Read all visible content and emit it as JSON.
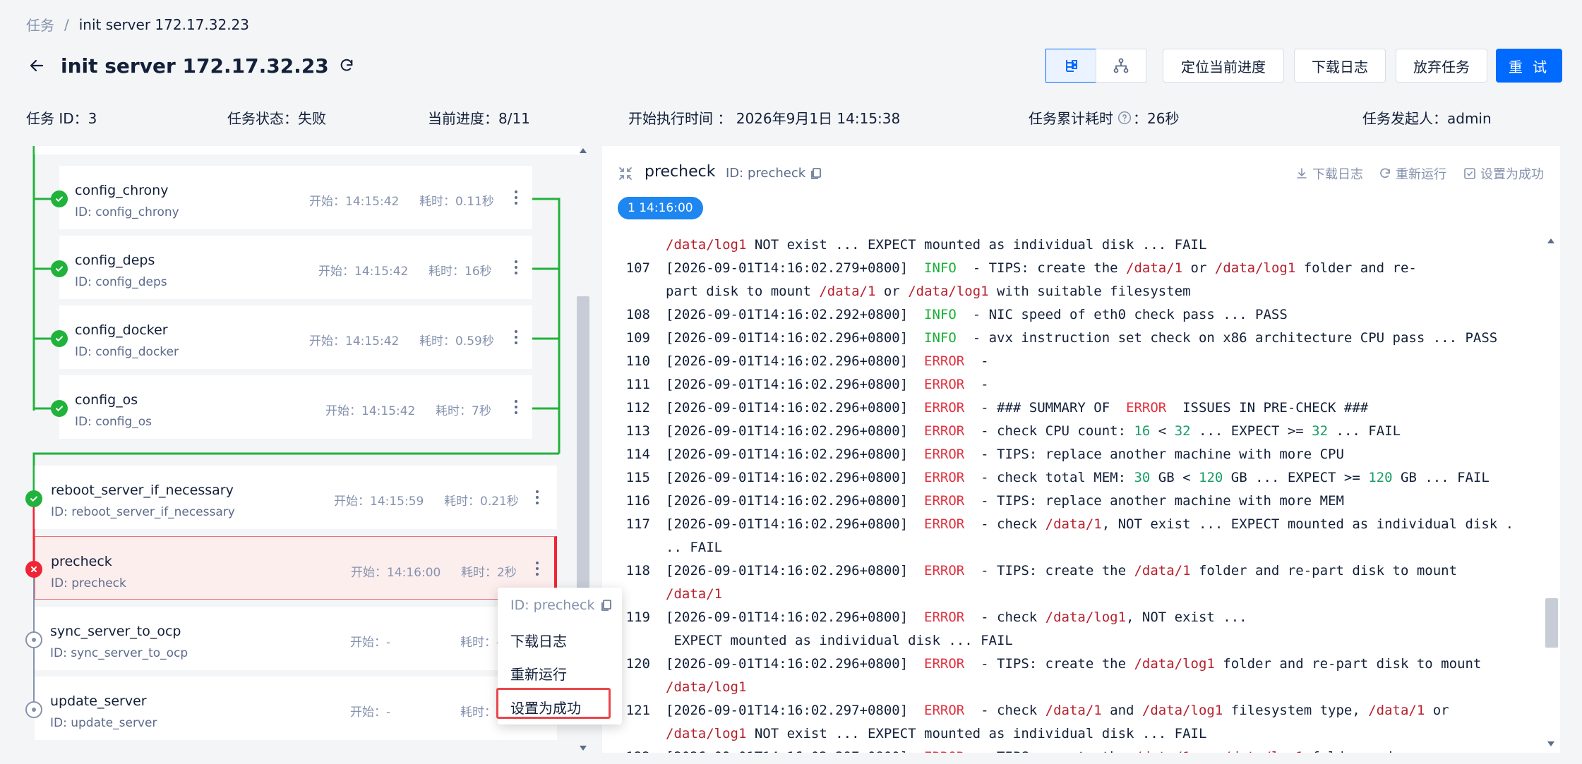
{
  "breadcrumb": {
    "root": "任务",
    "sep": "/",
    "current": "init server 172.17.32.23"
  },
  "title": "init server 172.17.32.23",
  "actions": {
    "locate": "定位当前进度",
    "download": "下载日志",
    "abandon": "放弃任务",
    "retry": "重 试"
  },
  "info": {
    "task_id": "任务 ID：3",
    "status": "任务状态：失败",
    "progress": "当前进度：8/11",
    "start_time": "开始执行时间 ： 2026年9月1日 14:15:38",
    "cost_label": "任务累计耗时",
    "cost_value": "：26秒",
    "initiator": "任务发起人：admin"
  },
  "nodes": [
    {
      "name": "config_chrony",
      "id": "ID: config_chrony",
      "start": "开始：14:15:42",
      "cost": "耗时：0.11秒",
      "status": "ok"
    },
    {
      "name": "config_deps",
      "id": "ID: config_deps",
      "start": "开始：14:15:42",
      "cost": "耗时：16秒",
      "status": "ok"
    },
    {
      "name": "config_docker",
      "id": "ID: config_docker",
      "start": "开始：14:15:42",
      "cost": "耗时：0.59秒",
      "status": "ok"
    },
    {
      "name": "config_os",
      "id": "ID: config_os",
      "start": "开始：14:15:42",
      "cost": "耗时：7秒",
      "status": "ok"
    },
    {
      "name": "reboot_server_if_necessary",
      "id": "ID: reboot_server_if_necessary",
      "start": "开始：14:15:59",
      "cost": "耗时：0.21秒",
      "status": "ok"
    },
    {
      "name": "precheck",
      "id": "ID: precheck",
      "start": "开始：14:16:00",
      "cost": "耗时：2秒",
      "status": "fail"
    },
    {
      "name": "sync_server_to_ocp",
      "id": "ID: sync_server_to_ocp",
      "start": "开始：-",
      "cost": "耗时：-",
      "status": "pending"
    },
    {
      "name": "update_server",
      "id": "ID: update_server",
      "start": "开始：-",
      "cost": "耗时：-",
      "status": "pending"
    }
  ],
  "context_menu": {
    "id": "ID: precheck",
    "download": "下载日志",
    "rerun": "重新运行",
    "set_success": "设置为成功"
  },
  "log_panel": {
    "name": "precheck",
    "id": "ID: precheck",
    "download": "下载日志",
    "rerun": "重新运行",
    "set_success": "设置为成功",
    "time_tag": "1 14:16:00"
  },
  "colors": {
    "primary": "#006aff",
    "success": "#21b23c",
    "error": "#ee2536",
    "info_text": "#19b034"
  }
}
